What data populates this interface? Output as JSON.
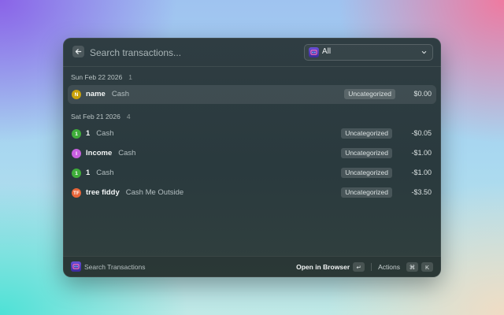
{
  "search": {
    "placeholder": "Search transactions...",
    "filter_label": "All"
  },
  "sections": [
    {
      "date": "Sun Feb 22 2026",
      "count": "1",
      "rows": [
        {
          "avatar": "N",
          "avatar_color": "#c9a20a",
          "title": "name",
          "account": "Cash",
          "category": "Uncategorized",
          "amount": "$0.00",
          "selected": true
        }
      ]
    },
    {
      "date": "Sat Feb 21 2026",
      "count": "4",
      "rows": [
        {
          "avatar": "1",
          "avatar_color": "#3fae3a",
          "title": "1",
          "account": "Cash",
          "category": "Uncategorized",
          "amount": "-$0.05",
          "selected": false
        },
        {
          "avatar": "I",
          "avatar_color": "#c85fe0",
          "title": "Income",
          "account": "Cash",
          "category": "Uncategorized",
          "amount": "-$1.00",
          "selected": false
        },
        {
          "avatar": "1",
          "avatar_color": "#3fae3a",
          "title": "1",
          "account": "Cash",
          "category": "Uncategorized",
          "amount": "-$1.00",
          "selected": false
        },
        {
          "avatar": "TF",
          "avatar_color": "#e8663a",
          "title": "tree fiddy",
          "account": "Cash Me Outside",
          "category": "Uncategorized",
          "amount": "-$3.50",
          "selected": false
        }
      ]
    }
  ],
  "footer": {
    "title": "Search Transactions",
    "primary_action": "Open in Browser",
    "primary_key": "↵",
    "secondary_action": "Actions",
    "secondary_keys": [
      "⌘",
      "K"
    ]
  },
  "icons": {
    "back": "arrow-left-icon",
    "filter": "app-logo-icon",
    "chevron": "chevron-down-icon",
    "footer_logo": "app-logo-icon"
  }
}
